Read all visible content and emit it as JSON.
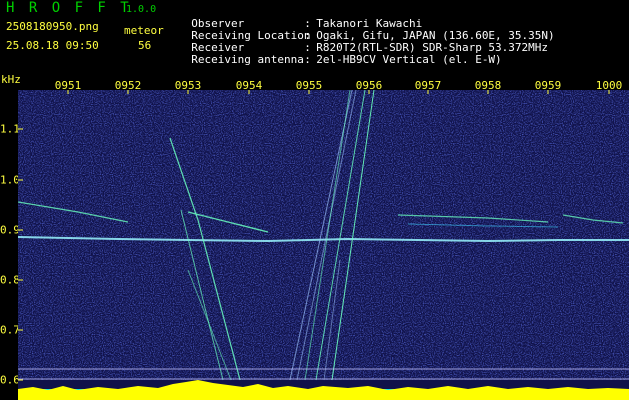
{
  "header": {
    "app_title": "H R O F F T",
    "app_version": "1.0.0",
    "filename": "2508180950.png",
    "datetime": "25.08.18 09:50",
    "meteor_label": "meteor",
    "meteor_count": "56"
  },
  "info": [
    {
      "label": "Observer",
      "sep": ":",
      "value": "Takanori Kawachi"
    },
    {
      "label": "Receiving Location",
      "sep": ":",
      "value": "Ogaki, Gifu, JAPAN (136.60E, 35.35N)"
    },
    {
      "label": "Receiver",
      "sep": ":",
      "value": "R820T2(RTL-SDR) SDR-Sharp 53.372MHz"
    },
    {
      "label": "Receiving antenna",
      "sep": ":",
      "value": "2el-HB9CV Vertical (el. E-W)"
    }
  ],
  "axis": {
    "unit": "kHz",
    "time_labels": [
      "0951",
      "0952",
      "0953",
      "0954",
      "0955",
      "0956",
      "0957",
      "0958",
      "0959",
      "1000"
    ],
    "freq_labels": [
      "1.1",
      "1.0",
      "0.9",
      "0.8",
      "0.7",
      "0.6"
    ]
  },
  "colors": {
    "background": "#10124a",
    "noise": "#1d2bb0",
    "label": "#ffff40",
    "title": "#00d000",
    "echo": "#6affc0",
    "carrier": "#9af7ff",
    "histogram_yellow": "#ffff00",
    "histogram_cyan": "#00e0ff"
  }
}
